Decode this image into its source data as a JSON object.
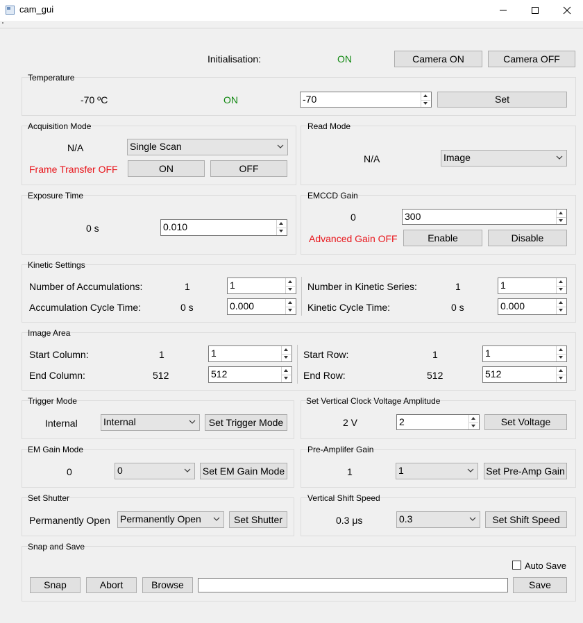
{
  "window": {
    "title": "cam_gui"
  },
  "init": {
    "label": "Initialisation:",
    "status": "ON",
    "camera_on": "Camera ON",
    "camera_off": "Camera OFF"
  },
  "temperature": {
    "title": "Temperature",
    "current": "-70 ºC",
    "status": "ON",
    "input": "-70",
    "set": "Set"
  },
  "acquisition": {
    "title": "Acquisition Mode",
    "status": "N/A",
    "mode": "Single Scan",
    "frame_transfer": "Frame Transfer OFF",
    "on": "ON",
    "off": "OFF"
  },
  "read_mode": {
    "title": "Read Mode",
    "status": "N/A",
    "mode": "Image"
  },
  "exposure": {
    "title": "Exposure Time",
    "current": "0 s",
    "input": "0.010"
  },
  "emccd": {
    "title": "EMCCD Gain",
    "current": "0",
    "input": "300",
    "advanced": "Advanced Gain OFF",
    "enable": "Enable",
    "disable": "Disable"
  },
  "kinetic": {
    "title": "Kinetic Settings",
    "num_acc_label": "Number of Accumulations:",
    "num_acc_val": "1",
    "num_acc_input": "1",
    "acc_cycle_label": "Accumulation Cycle Time:",
    "acc_cycle_val": "0 s",
    "acc_cycle_input": "0.000",
    "num_kin_label": "Number in Kinetic Series:",
    "num_kin_val": "1",
    "num_kin_input": "1",
    "kin_cycle_label": "Kinetic Cycle Time:",
    "kin_cycle_val": "0 s",
    "kin_cycle_input": "0.000"
  },
  "image_area": {
    "title": "Image Area",
    "start_col_label": "Start Column:",
    "start_col_val": "1",
    "start_col_input": "1",
    "end_col_label": "End Column:",
    "end_col_val": "512",
    "end_col_input": "512",
    "start_row_label": "Start Row:",
    "start_row_val": "1",
    "start_row_input": "1",
    "end_row_label": "End Row:",
    "end_row_val": "512",
    "end_row_input": "512"
  },
  "trigger": {
    "title": "Trigger Mode",
    "current": "Internal",
    "select": "Internal",
    "button": "Set Trigger Mode"
  },
  "vclock": {
    "title": "Set Vertical Clock Voltage Amplitude",
    "current": "2 V",
    "input": "2",
    "button": "Set Voltage"
  },
  "em_gain_mode": {
    "title": "EM Gain Mode",
    "current": "0",
    "select": "0",
    "button": "Set EM Gain Mode"
  },
  "preamp": {
    "title": "Pre-Amplifer Gain",
    "current": "1",
    "select": "1",
    "button": "Set Pre-Amp Gain"
  },
  "shutter": {
    "title": "Set Shutter",
    "current": "Permanently Open",
    "select": "Permanently Open",
    "button": "Set Shutter"
  },
  "vshift": {
    "title": "Vertical Shift Speed",
    "current": "0.3 μs",
    "select": "0.3",
    "button": "Set Shift Speed"
  },
  "snap": {
    "title": "Snap and Save",
    "auto_save": "Auto Save",
    "snap": "Snap",
    "abort": "Abort",
    "browse": "Browse",
    "path": "",
    "save": "Save"
  }
}
